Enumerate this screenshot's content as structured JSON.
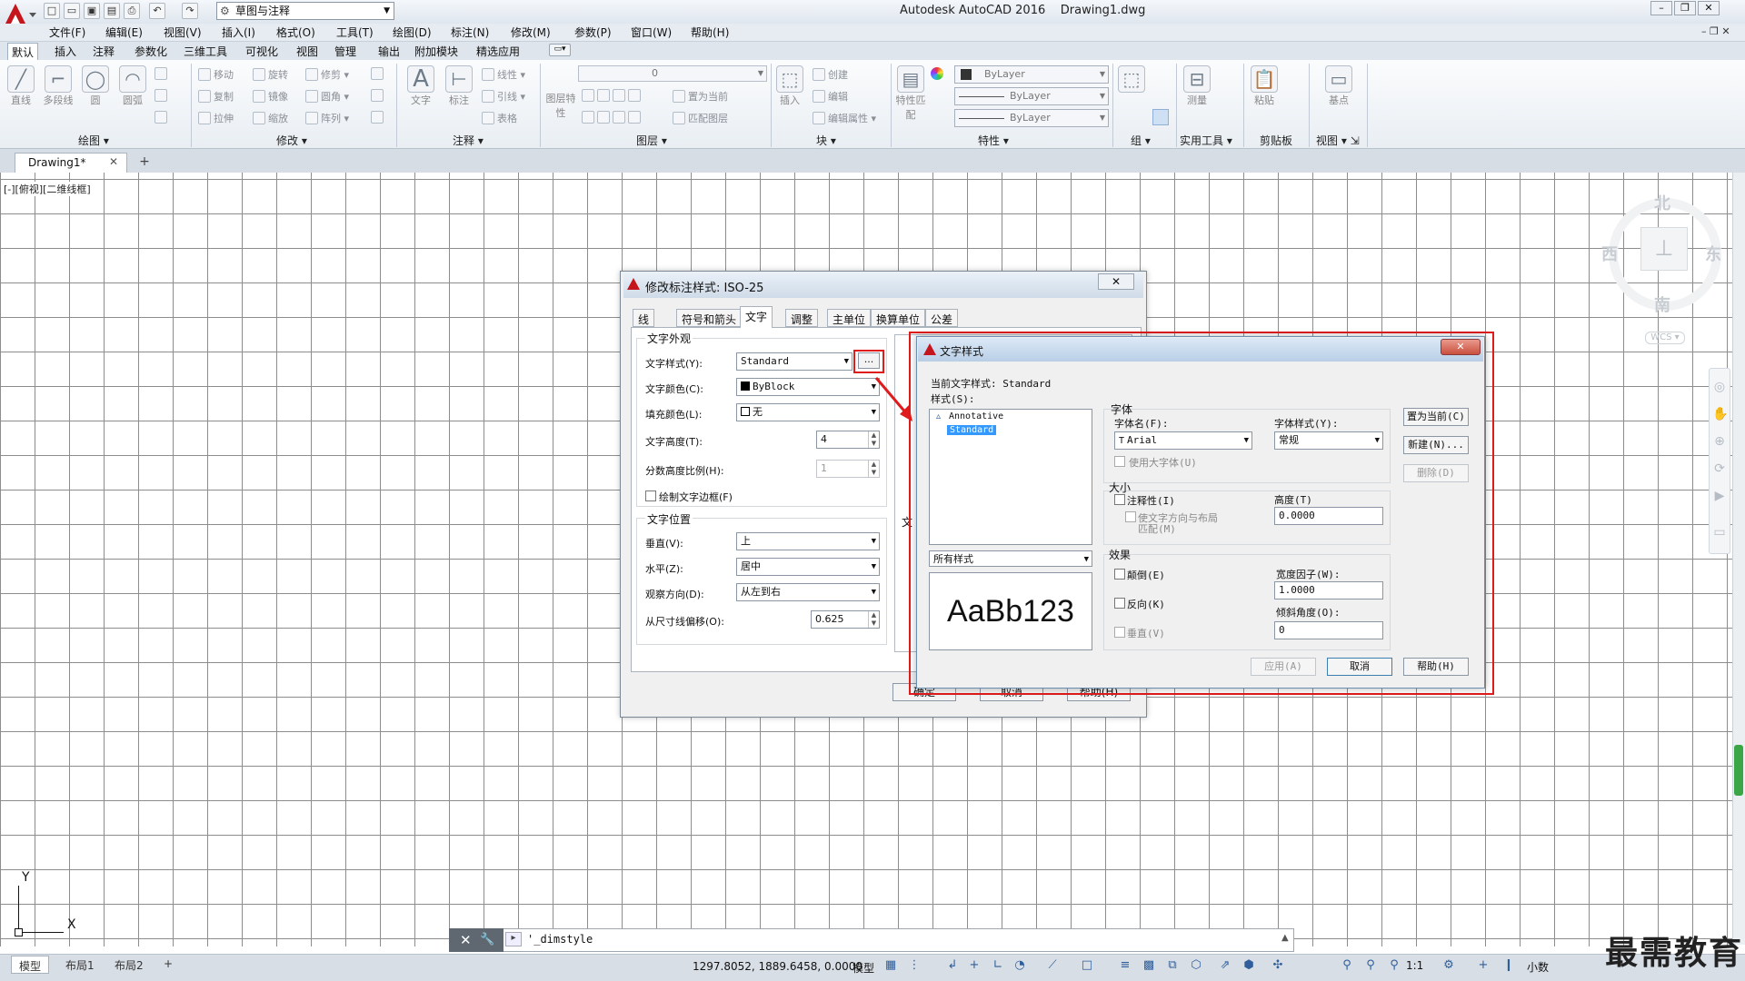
{
  "window": {
    "title": "Autodesk AutoCAD 2016",
    "doc_name": "Drawing1.dwg"
  },
  "quick_access": {
    "workspace": "草图与注释"
  },
  "menu": [
    "文件(F)",
    "编辑(E)",
    "视图(V)",
    "插入(I)",
    "格式(O)",
    "工具(T)",
    "绘图(D)",
    "标注(N)",
    "修改(M)",
    "参数(P)",
    "窗口(W)",
    "帮助(H)"
  ],
  "ribbon_tabs": [
    "默认",
    "插入",
    "注释",
    "参数化",
    "三维工具",
    "可视化",
    "视图",
    "管理",
    "输出",
    "附加模块",
    "精选应用"
  ],
  "ribbon": {
    "draw": {
      "tools": [
        "直线",
        "多段线",
        "圆",
        "圆弧"
      ],
      "title": "绘图"
    },
    "modify": {
      "tools": [
        "移动",
        "旋转",
        "修剪",
        "复制",
        "镜像",
        "圆角",
        "拉伸",
        "缩放",
        "阵列"
      ],
      "title": "修改"
    },
    "annotation": {
      "tools": [
        "文字",
        "标注",
        "线性",
        "引线",
        "表格"
      ],
      "title": "注释"
    },
    "layers": {
      "tools": [
        "图层特性",
        "置为当前",
        "匹配图层"
      ],
      "layer_value": "0",
      "title": "图层"
    },
    "block": {
      "tools": [
        "插入",
        "创建",
        "编辑",
        "编辑属性"
      ],
      "title": "块"
    },
    "properties": {
      "tools": [
        "特性匹配"
      ],
      "color": "ByLayer",
      "linetype": "ByLayer",
      "lineweight": "ByLayer",
      "title": "特性"
    },
    "groups": {
      "title": "组"
    },
    "utilities": {
      "tools": [
        "测量"
      ],
      "title": "实用工具"
    },
    "clipboard": {
      "tools": [
        "粘贴"
      ],
      "title": "剪贴板"
    },
    "view": {
      "tools": [
        "基点"
      ],
      "title": "视图"
    }
  },
  "doc_tab": {
    "name": "Drawing1*"
  },
  "viewport": {
    "label": "[-][俯视][二维线框]"
  },
  "viewcube": {
    "north": "北",
    "south": "南",
    "east": "东",
    "west": "西",
    "wcs": "WCS"
  },
  "ucs": {
    "x": "X",
    "y": "Y"
  },
  "command_line": {
    "text": "'_dimstyle"
  },
  "status": {
    "layouts": [
      "模型",
      "布局1",
      "布局2"
    ],
    "coords": "1297.8052, 1889.6458, 0.0000",
    "model": "模型",
    "scale": "1:1",
    "units": "小数"
  },
  "watermark": "最需教育",
  "dimstyle_dialog": {
    "title": "修改标注样式: ISO-25",
    "tabs": [
      "线",
      "符号和箭头",
      "文字",
      "调整",
      "主单位",
      "换算单位",
      "公差"
    ],
    "active_tab": "文字",
    "appearance": {
      "group": "文字外观",
      "style_label": "文字样式(Y):",
      "style_value": "Standard",
      "color_label": "文字颜色(C):",
      "color_value": "ByBlock",
      "fill_label": "填充颜色(L):",
      "fill_value": "无",
      "height_label": "文字高度(T):",
      "height_value": "4",
      "fraction_label": "分数高度比例(H):",
      "fraction_value": "1",
      "frame_label": "绘制文字边框(F)"
    },
    "placement": {
      "group": "文字位置",
      "vertical_label": "垂直(V):",
      "vertical_value": "上",
      "horizontal_label": "水平(Z):",
      "horizontal_value": "居中",
      "direction_label": "观察方向(D):",
      "direction_value": "从左到右",
      "offset_label": "从尺寸线偏移(O):",
      "offset_value": "0.625"
    },
    "alignment_group": "文",
    "buttons": {
      "ok": "确定",
      "cancel": "取消",
      "help": "帮助(H)"
    }
  },
  "textstyle_dialog": {
    "title": "文字样式",
    "current_label": "当前文字样式:",
    "current_value": "Standard",
    "styles_label": "样式(S):",
    "styles": [
      "Annotative",
      "Standard"
    ],
    "selected_style": "Standard",
    "filter_value": "所有样式",
    "preview_text": "AaBb123",
    "font": {
      "group": "字体",
      "name_label": "字体名(F):",
      "name_value": "Arial",
      "style_label": "字体样式(Y):",
      "style_value": "常规",
      "bigfont_label": "使用大字体(U)"
    },
    "size": {
      "group": "大小",
      "annotative_label": "注释性(I)",
      "match_label_1": "使文字方向与布局",
      "match_label_2": "匹配(M)",
      "height_label": "高度(T)",
      "height_value": "0.0000"
    },
    "effects": {
      "group": "效果",
      "upside_label": "颠倒(E)",
      "backwards_label": "反向(K)",
      "vertical_label": "垂直(V)",
      "width_label": "宽度因子(W):",
      "width_value": "1.0000",
      "oblique_label": "倾斜角度(O):",
      "oblique_value": "0"
    },
    "buttons": {
      "set_current": "置为当前(C)",
      "new": "新建(N)...",
      "delete": "删除(D)",
      "apply": "应用(A)",
      "cancel": "取消",
      "help": "帮助(H)"
    }
  }
}
